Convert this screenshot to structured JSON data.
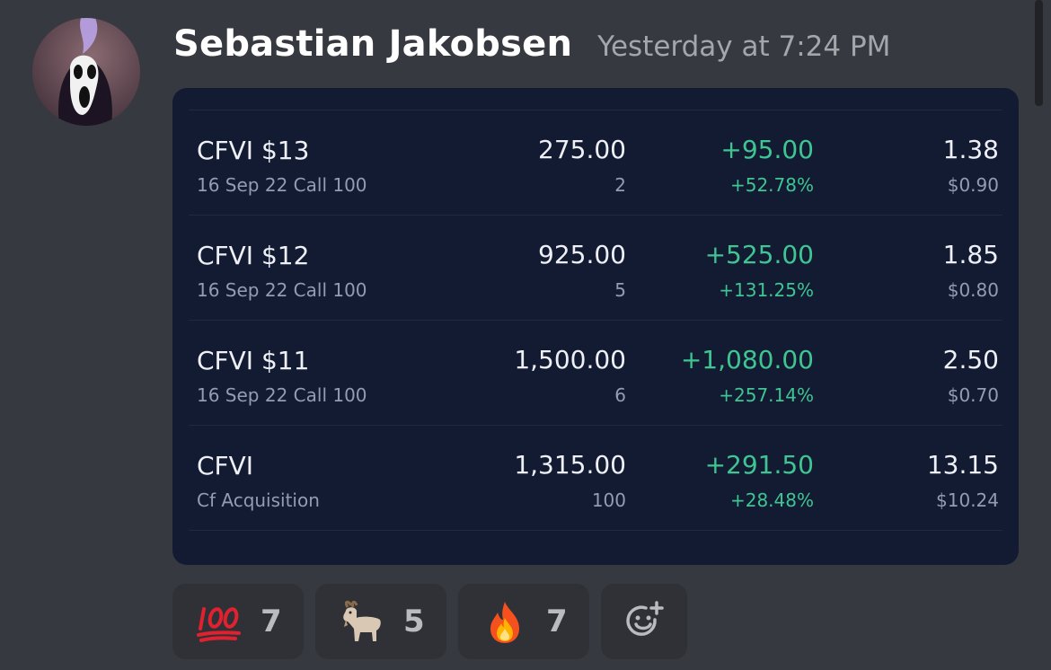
{
  "message": {
    "author": "Sebastian Jakobsen",
    "timestamp": "Yesterday at 7:24 PM"
  },
  "positions": [
    {
      "name": "CFVI $13",
      "detail": "16 Sep 22  Call 100",
      "market_value": "275.00",
      "quantity": "2",
      "pl": "+95.00",
      "pl_pct": "+52.78%",
      "price": "1.38",
      "avg_cost": "$0.90"
    },
    {
      "name": "CFVI $12",
      "detail": "16 Sep 22  Call 100",
      "market_value": "925.00",
      "quantity": "5",
      "pl": "+525.00",
      "pl_pct": "+131.25%",
      "price": "1.85",
      "avg_cost": "$0.80"
    },
    {
      "name": "CFVI $11",
      "detail": "16 Sep 22  Call 100",
      "market_value": "1,500.00",
      "quantity": "6",
      "pl": "+1,080.00",
      "pl_pct": "+257.14%",
      "price": "2.50",
      "avg_cost": "$0.70"
    },
    {
      "name": "CFVI",
      "detail": "Cf Acquisition",
      "market_value": "1,315.00",
      "quantity": "100",
      "pl": "+291.50",
      "pl_pct": "+28.48%",
      "price": "13.15",
      "avg_cost": "$10.24"
    }
  ],
  "reactions": [
    {
      "icon": "hundred-points-icon",
      "count": "7"
    },
    {
      "icon": "goat-icon",
      "count": "5"
    },
    {
      "icon": "fire-icon",
      "count": "7"
    }
  ],
  "add_reaction_icon": "add-reaction-icon",
  "colors": {
    "background": "#36393f",
    "card": "#131b33",
    "gain": "#3ec592",
    "reaction_bg": "#2f3136"
  }
}
